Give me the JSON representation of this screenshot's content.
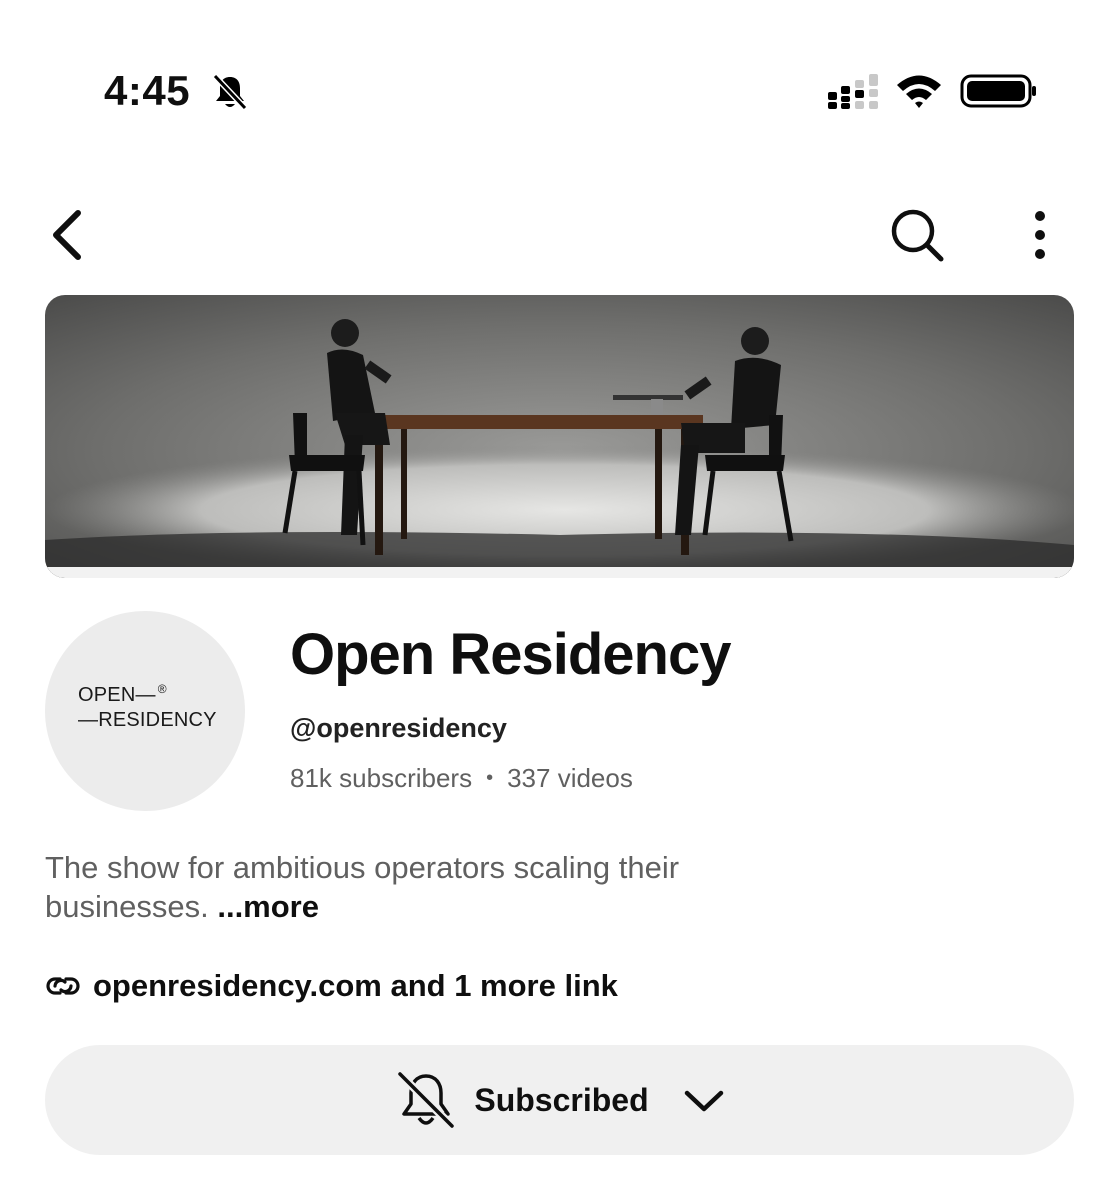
{
  "status_bar": {
    "time": "4:45",
    "icons": [
      "bell-slash-icon",
      "signal-icon",
      "wifi-icon",
      "battery-icon"
    ]
  },
  "top_nav": {
    "icons": [
      "chevron-left-icon",
      "search-icon",
      "more-vertical-icon"
    ]
  },
  "channel": {
    "name": "Open Residency",
    "handle": "@openresidency",
    "subscribers": "81k subscribers",
    "separator": "•",
    "videos": "337 videos",
    "avatar_text": {
      "line1": "OPEN—",
      "registered": "®",
      "line2": "—RESIDENCY"
    },
    "description": "The show for ambitious operators scaling their businesses.",
    "more_label": "...more",
    "links_text": "openresidency.com and 1 more link"
  },
  "subscribe": {
    "label": "Subscribed",
    "icons": [
      "bell-slash-icon",
      "chevron-down-icon"
    ]
  },
  "colors": {
    "background": "#ffffff",
    "text_primary": "#0f0f0f",
    "text_secondary": "#606060",
    "button_bg": "#f0f0f0",
    "avatar_bg": "#ececec"
  }
}
